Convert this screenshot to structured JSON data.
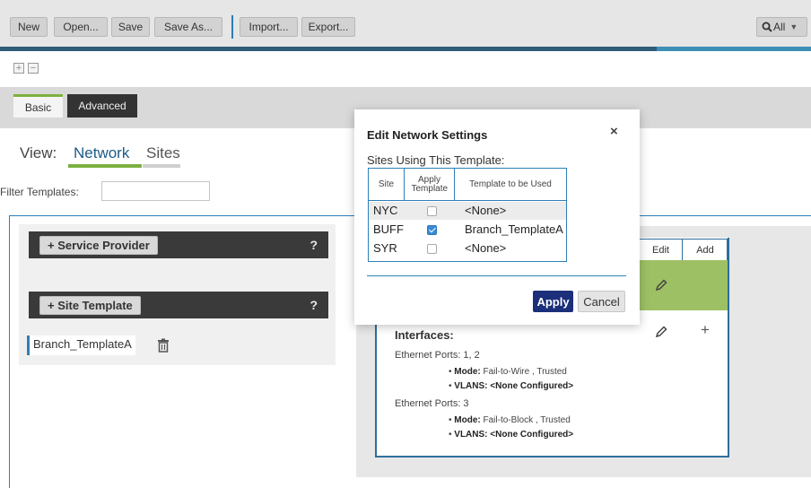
{
  "toolbar": {
    "new_label": "New",
    "open_label": "Open...",
    "save_label": "Save",
    "save_as_label": "Save As...",
    "import_label": "Import...",
    "export_label": "Export...",
    "search_label": "All",
    "search_icon": "search-icon"
  },
  "progress": {
    "value": 0.81,
    "bar_color": "#2e5d79",
    "tail_color": "#3e8fb6"
  },
  "expand_collapse": {
    "expand": "+",
    "collapse": "−"
  },
  "tabs": [
    {
      "label": "Basic",
      "active": true
    },
    {
      "label": "Advanced",
      "active": false
    }
  ],
  "view": {
    "label": "View:",
    "options": [
      {
        "label": "Network",
        "active": true
      },
      {
        "label": "Sites",
        "active": false
      }
    ]
  },
  "filter": {
    "label": "Filter Templates:",
    "value": ""
  },
  "sections": [
    {
      "label": "+ Service Provider",
      "help": "?"
    },
    {
      "label": "+ Site Template",
      "help": "?"
    }
  ],
  "templates": [
    {
      "name": "Branch_TemplateA"
    }
  ],
  "card": {
    "header_edit": "Edit",
    "header_add": "Add",
    "interfaces_title": "Interfaces:",
    "ports": [
      {
        "label": "Ethernet Ports: 1, 2",
        "mode_label": "Mode:",
        "mode_value": "Fail-to-Wire , Trusted",
        "vlans_label": "VLANS:",
        "vlans_value": "<None Configured>"
      },
      {
        "label": "Ethernet Ports: 3",
        "mode_label": "Mode:",
        "mode_value": "Fail-to-Block , Trusted",
        "vlans_label": "VLANS:",
        "vlans_value": "<None Configured>"
      }
    ],
    "add_symbol": "+"
  },
  "modal": {
    "title": "Edit Network Settings",
    "close": "×",
    "subtitle": "Sites Using This Template:",
    "columns": {
      "site": "Site",
      "apply": "Apply Template",
      "template": "Template to be Used"
    },
    "rows": [
      {
        "site": "NYC",
        "apply": false,
        "template": "<None>"
      },
      {
        "site": "BUFF",
        "apply": true,
        "template": "Branch_TemplateA"
      },
      {
        "site": "SYR",
        "apply": false,
        "template": "<None>"
      }
    ],
    "apply_label": "Apply",
    "cancel_label": "Cancel"
  },
  "colors": {
    "accent_green": "#7db040",
    "accent_blue": "#2e7fb8",
    "primary_button": "#1b2f7a"
  }
}
